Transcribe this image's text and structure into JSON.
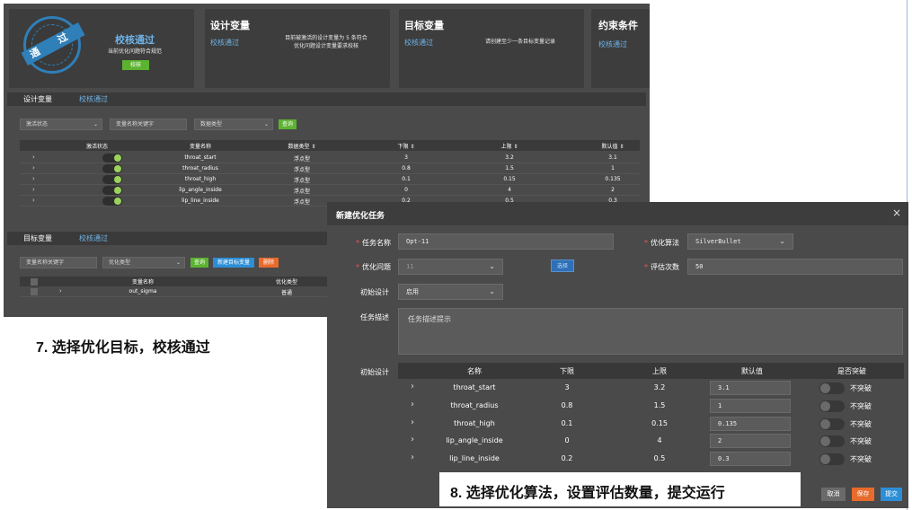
{
  "summary_cards": {
    "status": {
      "title": "校核通过",
      "desc": "当前优化问题符合规范",
      "button": "校核",
      "stamp_text": "通 过"
    },
    "design_vars": {
      "title": "设计变量",
      "link": "校核通过",
      "desc_line1": "目前被激活的设计变量为 5 条符合",
      "desc_line2": "优化问题设计变量要求校核"
    },
    "target_vars": {
      "title": "目标变量",
      "link": "校核通过",
      "desc": "请创建至少一条目标变量记录"
    },
    "constraints": {
      "title": "约束条件",
      "link": "校核通过"
    }
  },
  "design_section": {
    "title": "设计变量",
    "status": "校核通过",
    "filters": {
      "activation": "激活状态",
      "keyword": "变量名称关键字",
      "data_type": "数据类型",
      "query": "查询"
    },
    "headers": [
      "激活状态",
      "变量名称",
      "数据类型 ⇕",
      "下限 ⇕",
      "上限 ⇕",
      "默认值 ⇕"
    ],
    "rows": [
      {
        "name": "throat_start",
        "type": "浮点型",
        "lower": "3",
        "upper": "3.2",
        "default": "3.1"
      },
      {
        "name": "throat_radius",
        "type": "浮点型",
        "lower": "0.8",
        "upper": "1.5",
        "default": "1"
      },
      {
        "name": "throat_high",
        "type": "浮点型",
        "lower": "0.1",
        "upper": "0.15",
        "default": "0.135"
      },
      {
        "name": "lip_angle_inside",
        "type": "浮点型",
        "lower": "0",
        "upper": "4",
        "default": "2"
      },
      {
        "name": "lip_line_inside",
        "type": "浮点型",
        "lower": "0.2",
        "upper": "0.5",
        "default": "0.3"
      }
    ]
  },
  "target_section": {
    "title": "目标变量",
    "status": "校核通过",
    "filters": {
      "keyword": "变量名称关键字",
      "opt_type": "优化类型",
      "query": "查询",
      "new": "新建目标变量",
      "delete": "删除"
    },
    "headers": [
      "变量名称",
      "优化类型"
    ],
    "rows": [
      {
        "name": "out_sigma",
        "type": "普通"
      }
    ]
  },
  "caption7": "7. 选择优化目标，校核通过",
  "dialog": {
    "title": "新建优化任务",
    "close": "×",
    "task_name_label": "任务名称",
    "task_name_value": "Opt-11",
    "algo_label": "优化算法",
    "algo_value": "SilverBullet",
    "problem_label": "优化问题",
    "problem_value": "11",
    "choose_button": "选择",
    "eval_label": "评估次数",
    "eval_value": "50",
    "init_design_label": "初始设计",
    "init_design_value": "启用",
    "desc_label": "任务描述",
    "desc_placeholder": "任务描述提示",
    "table_label": "初始设计",
    "headers": [
      "名称",
      "下限",
      "上限",
      "默认值",
      "是否突破"
    ],
    "rows": [
      {
        "name": "throat_start",
        "lower": "3",
        "upper": "3.2",
        "default": "3.1",
        "breach": "不突破"
      },
      {
        "name": "throat_radius",
        "lower": "0.8",
        "upper": "1.5",
        "default": "1",
        "breach": "不突破"
      },
      {
        "name": "throat_high",
        "lower": "0.1",
        "upper": "0.15",
        "default": "0.135",
        "breach": "不突破"
      },
      {
        "name": "lip_angle_inside",
        "lower": "0",
        "upper": "4",
        "default": "2",
        "breach": "不突破"
      },
      {
        "name": "lip_line_inside",
        "lower": "0.2",
        "upper": "0.5",
        "default": "0.3",
        "breach": "不突破"
      }
    ],
    "cancel": "取消",
    "save": "保存",
    "submit": "提交"
  },
  "caption8": "8. 选择优化算法，设置评估数量，提交运行",
  "colors": {
    "panel": "#4a4a4a",
    "link": "#6fb3e8",
    "green": "#5cb331",
    "blue": "#2d8ed6",
    "orange": "#e86a2c"
  }
}
